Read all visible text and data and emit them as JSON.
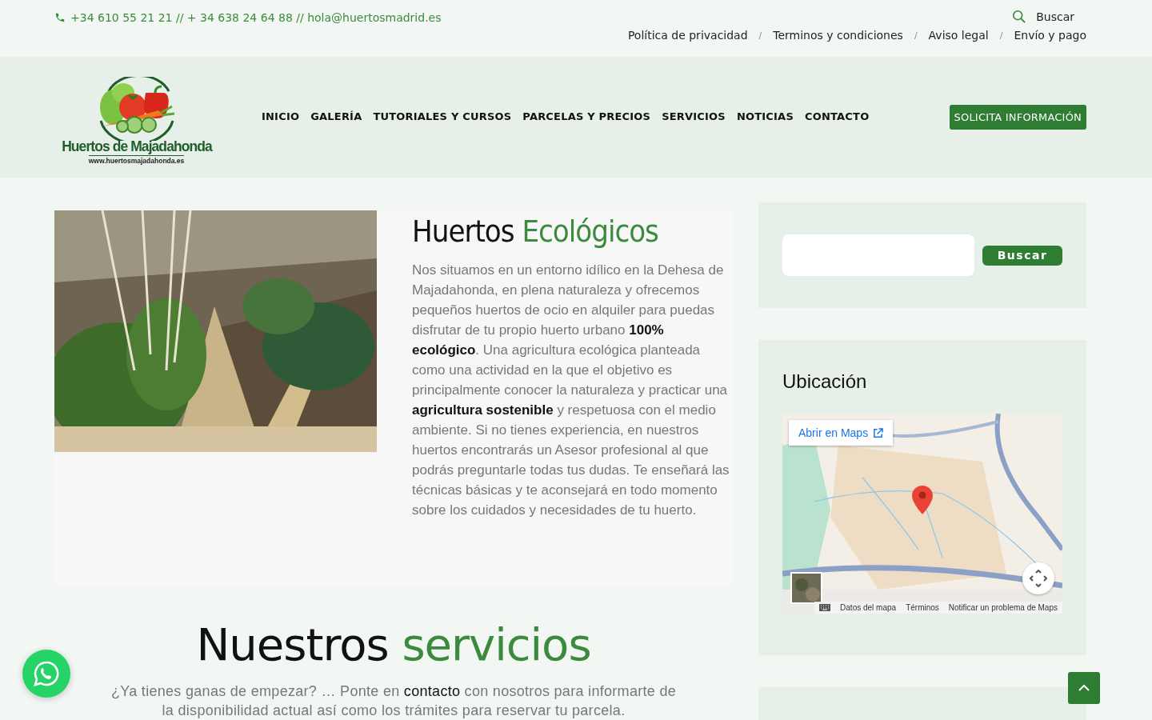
{
  "topbar": {
    "contact": "+34 610 55 21 21 // + 34 638 24 64 88 // hola@huertosmadrid.es",
    "search_label": "Buscar",
    "links": [
      "Política de privacidad",
      "Terminos y condiciones",
      "Aviso legal",
      "Envío y pago"
    ],
    "separator": "/"
  },
  "header": {
    "logo": {
      "name": "Huertos de Majadahonda",
      "url": "www.huertosmajadahonda.es"
    },
    "nav": [
      {
        "label": "INICIO",
        "selected": false
      },
      {
        "label": "GALERÍA",
        "selected": false
      },
      {
        "label": "TUTORIALES Y CURSOS",
        "selected": false
      },
      {
        "label": "PARCELAS Y PRECIOS",
        "selected": false
      },
      {
        "label": "SERVICIOS",
        "selected": false
      },
      {
        "label": "NOTICIAS",
        "selected": false
      },
      {
        "label": "CONTACTO",
        "selected": false
      }
    ],
    "cta": "SOLICITA INFORMACIÓN"
  },
  "intro": {
    "heading": {
      "text": "Huertos",
      "accent": "Ecológicos"
    },
    "body": "Nos situamos en un entorno idílico en la Dehesa de Majadahonda, en plena naturaleza y ofrecemos pequeños huertos de ocio en alquiler para puedas disfrutar de tu propio huerto urbano **100% ecológico**. Una agricultura ecológica planteada como una actividad en la que el objetivo es principalmente conocer la naturaleza y practicar una **agricultura sostenible** y respetuosa con el medio ambiente. Si no tienes experiencia, en nuestros huertos encontrarás un Asesor profesional al que podrás preguntarle todas tus dudas. Te enseñará las técnicas básicas y te aconsejará en todo momento sobre los cuidados y necesidades de tu huerto."
  },
  "services": {
    "heading": {
      "text": "Nuestros",
      "accent": "servicios"
    },
    "text_before": "¿Ya tienes ganas de empezar? … Ponte en ",
    "link": "contacto",
    "text_after": " con nosotros para informarte de la disponibilidad actual así como los trámites para reservar tu parcela."
  },
  "sidebar": {
    "search_button": "Buscar",
    "location_title": "Ubicación",
    "map": {
      "open_label": "Abrir en Maps",
      "footer": [
        "Datos del mapa",
        "Términos",
        "Notificar un problema de Maps"
      ]
    }
  }
}
